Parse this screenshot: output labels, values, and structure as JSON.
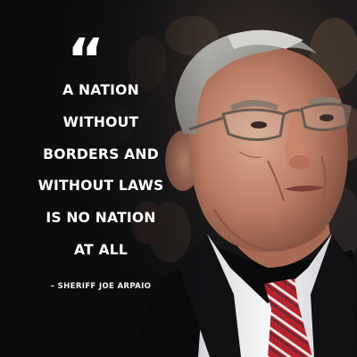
{
  "quote": {
    "mark": "“",
    "lines": [
      "A NATION",
      "WITHOUT",
      "BORDERS AND",
      "WITHOUT LAWS",
      "IS NO NATION",
      "AT ALL"
    ],
    "attribution": "– SHERIFF JOE ARPAIO"
  },
  "colors": {
    "text": "#ffffff",
    "background": "#101012",
    "tie_red": "#b3232b",
    "suit": "#0a0a0c"
  }
}
